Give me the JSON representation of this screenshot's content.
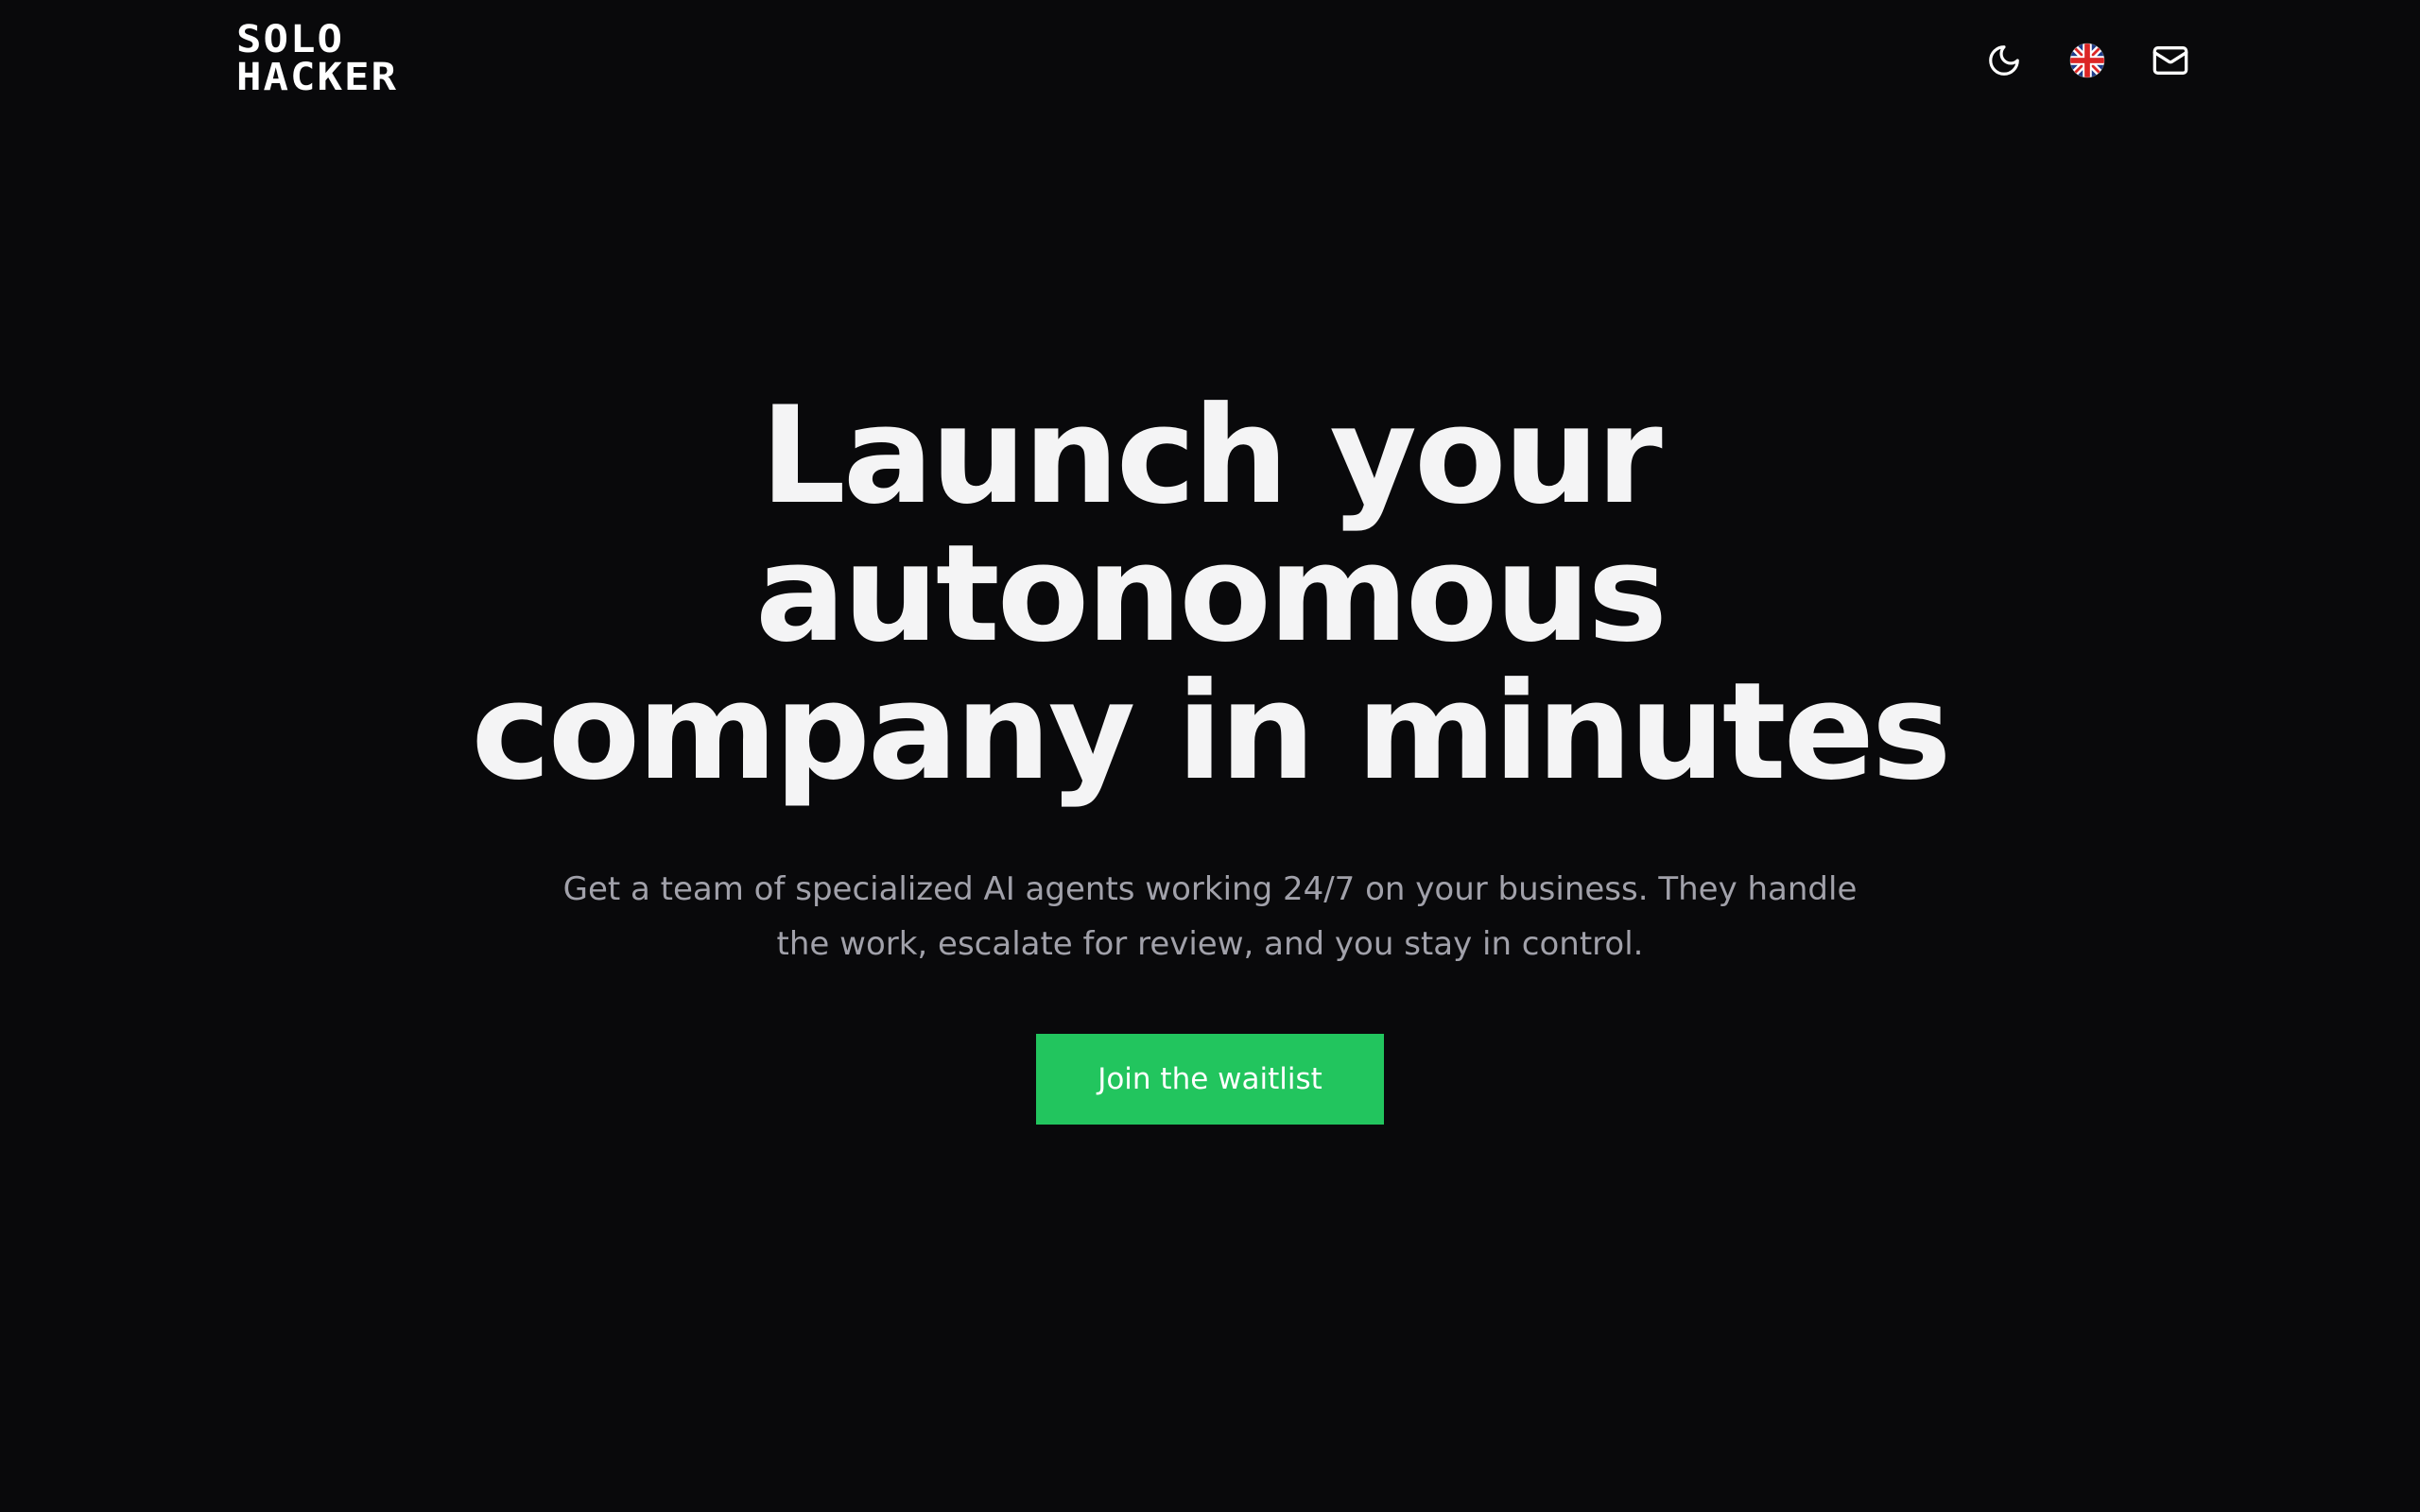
{
  "header": {
    "logo": {
      "line1": "SOLO",
      "line2": "HACKER"
    },
    "actions": {
      "theme_icon": "moon-icon",
      "language_icon": "uk-flag-icon",
      "contact_icon": "mail-icon"
    }
  },
  "hero": {
    "title_lines": [
      "Launch your",
      "autonomous",
      "company in minutes"
    ],
    "subtitle_line1": "Get a team of specialized AI agents working 24/7 on your business. They handle",
    "subtitle_line2": "the work, escalate for review, and you stay in control.",
    "cta_label": "Join the waitlist"
  },
  "colors": {
    "background": "#09090b",
    "text": "#ffffff",
    "muted_text": "#a1a1aa",
    "accent": "#22c55e"
  }
}
